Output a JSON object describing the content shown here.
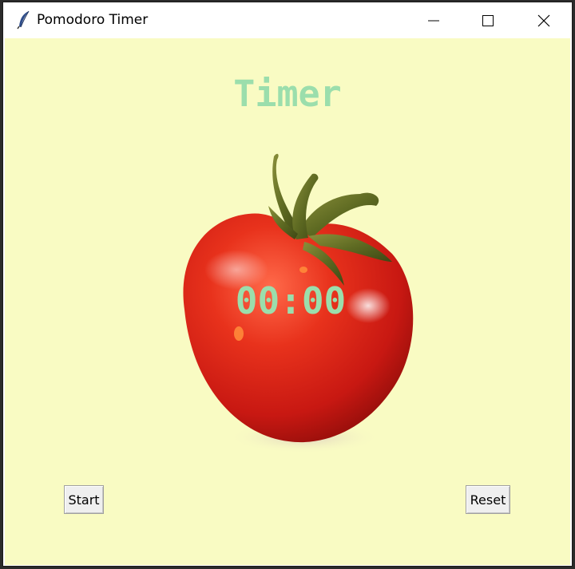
{
  "window": {
    "title": "Pomodoro Timer",
    "controls": {
      "minimize": "minimize",
      "maximize": "maximize",
      "close": "close"
    }
  },
  "timer": {
    "heading": "Timer",
    "countdown": "00:00"
  },
  "buttons": {
    "start_label": "Start",
    "reset_label": "Reset"
  },
  "colors": {
    "background": "#f9fbc3",
    "accent_green": "#9bdeac",
    "tomato_red": "#e7301c"
  },
  "icons": [
    "feather-icon",
    "minimize-icon",
    "maximize-icon",
    "close-icon",
    "tomato-image"
  ]
}
